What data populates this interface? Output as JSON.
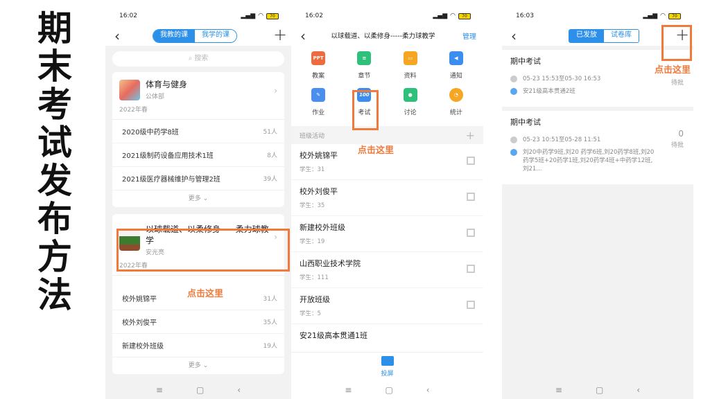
{
  "title_chars": [
    "期",
    "末",
    "考",
    "试",
    "发",
    "布",
    "方",
    "法"
  ],
  "colors": {
    "accent": "#2c8fe8",
    "highlight": "#f07a3c"
  },
  "phone1": {
    "time": "16:02",
    "battery": "70",
    "tabs": [
      "我教的课",
      "我学的课"
    ],
    "search_placeholder": "搜索",
    "course1": {
      "title": "体育与健身",
      "dept": "公体部",
      "term": "2022年春",
      "classes": [
        {
          "name": "2020级中药学8班",
          "count": "51人"
        },
        {
          "name": "2021级制药设备应用技术1班",
          "count": "8人"
        },
        {
          "name": "2021级医疗器械维护与管理2班",
          "count": "39人"
        }
      ],
      "more": "更多"
    },
    "course2": {
      "title": "以球载道、以柔修身-----柔力球教学",
      "teacher": "安光亮",
      "term": "2022年春",
      "classes": [
        {
          "name": "校外姚锦平",
          "count": "31人"
        },
        {
          "name": "校外刘俊平",
          "count": "35人"
        },
        {
          "name": "新建校外班级",
          "count": "19人"
        }
      ],
      "more": "更多"
    },
    "hint": "点击这里"
  },
  "phone2": {
    "time": "16:02",
    "battery": "70",
    "title": "以球载道、以柔修身-----柔力球教学",
    "manage": "管理",
    "grid": [
      {
        "label": "教案",
        "icon": "ppt-icon",
        "color": "#ef6a3c",
        "glyph": "PPT"
      },
      {
        "label": "章节",
        "icon": "chapter-icon",
        "color": "#2fc07b",
        "glyph": "≡"
      },
      {
        "label": "资料",
        "icon": "folder-icon",
        "color": "#f5a623",
        "glyph": "▭"
      },
      {
        "label": "通知",
        "icon": "speaker-icon",
        "color": "#3b8ef0",
        "glyph": "◀"
      },
      {
        "label": "作业",
        "icon": "homework-icon",
        "color": "#4a8ff0",
        "glyph": "✎"
      },
      {
        "label": "考试",
        "icon": "exam-icon",
        "color": "#3b8ef0",
        "glyph": "100"
      },
      {
        "label": "讨论",
        "icon": "discuss-icon",
        "color": "#2fc07b",
        "glyph": "●"
      },
      {
        "label": "统计",
        "icon": "stats-icon",
        "color": "#f5a623",
        "glyph": "◔"
      }
    ],
    "section": "班级活动",
    "hint": "点击这里",
    "classes": [
      {
        "name": "校外姚锦平",
        "students": "学生：31"
      },
      {
        "name": "校外刘俊平",
        "students": "学生：35"
      },
      {
        "name": "新建校外班级",
        "students": "学生：19"
      },
      {
        "name": "山西职业技术学院",
        "students": "学生：111"
      },
      {
        "name": "开放班级",
        "students": "学生：5"
      },
      {
        "name": "安21级高本贯通1班",
        "students": ""
      }
    ],
    "screen": "投屏"
  },
  "phone3": {
    "time": "16:03",
    "battery": "70",
    "tabs": [
      "已发放",
      "试卷库"
    ],
    "hint": "点击这里",
    "exams": [
      {
        "title": "期中考试",
        "time": "05-23 15:53至05-30 16:53",
        "classes": "安21级高本贯通2班",
        "count": "",
        "status": "待批"
      },
      {
        "title": "期中考试",
        "time": "05-23 10:51至05-28 11:51",
        "classes": "刘20中药学9班,刘20 药学6班,刘20药学8班,刘20药学5班+20药学1班,刘20药学4班+中药学12班,刘21...",
        "count": "0",
        "status": "待批"
      }
    ]
  }
}
